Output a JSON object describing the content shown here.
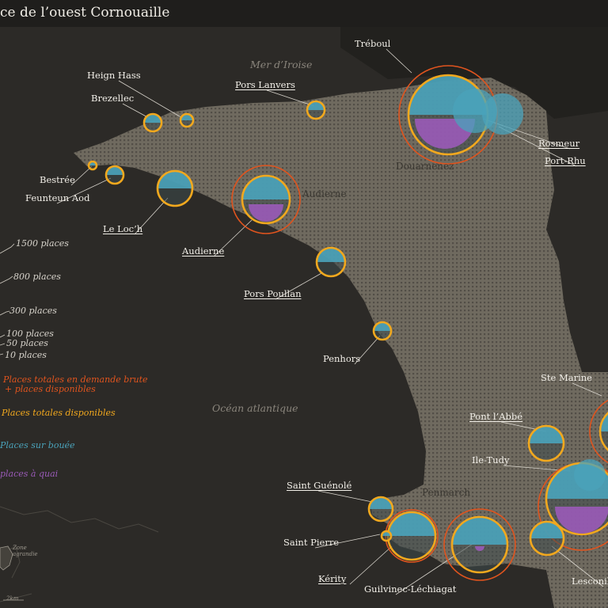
{
  "title": "ce de l’ouest Cornouaille",
  "sea_labels": {
    "iroise": "Mer d’Iroise",
    "atlantic": "Océan atlantique"
  },
  "town_labels": {
    "douarnenez": "Douarnenez",
    "audierne": "Audierne",
    "penmarch": "Penmarch"
  },
  "inset": {
    "zone_label": "Zone\nagrandie",
    "scale": "2km"
  },
  "legend": {
    "sizes": [
      "1500 places",
      "800 places",
      "300 places",
      "100 places",
      "50 places",
      "10 places"
    ],
    "categories": [
      {
        "label": "Places totales en demande brute\n+ places disponibles",
        "color": "#e0541e"
      },
      {
        "label": "Places totales disponibles",
        "color": "#f1a81e"
      },
      {
        "label": "Places sur bouée",
        "color": "#4aa3bb"
      },
      {
        "label": "places à quai",
        "color": "#9a5ab8"
      }
    ]
  },
  "colors": {
    "demand": "#e0541e",
    "available": "#f1a81e",
    "buoy": "#4aa3bb",
    "quay": "#9a5ab8",
    "land": "#6f6a5f",
    "sea": "#2c2a27"
  },
  "ports": [
    {
      "name": "Tréboul"
    },
    {
      "name": "Rosmeur"
    },
    {
      "name": "Port-Rhu"
    },
    {
      "name": "Heign Hass"
    },
    {
      "name": "Brezellec"
    },
    {
      "name": "Pors Lanvers"
    },
    {
      "name": "Bestrée"
    },
    {
      "name": "Feunteun Aod"
    },
    {
      "name": "Le Loc’h"
    },
    {
      "name": "Audierne"
    },
    {
      "name": "Pors Poullan"
    },
    {
      "name": "Penhors"
    },
    {
      "name": "Ste Marine"
    },
    {
      "name": "Pont l’Abbé"
    },
    {
      "name": "Ile-Tudy"
    },
    {
      "name": "Saint Guénolé"
    },
    {
      "name": "Saint Pierre"
    },
    {
      "name": "Kérity"
    },
    {
      "name": "Guilvinec-Léchiagat"
    },
    {
      "name": "Lesconil"
    }
  ]
}
